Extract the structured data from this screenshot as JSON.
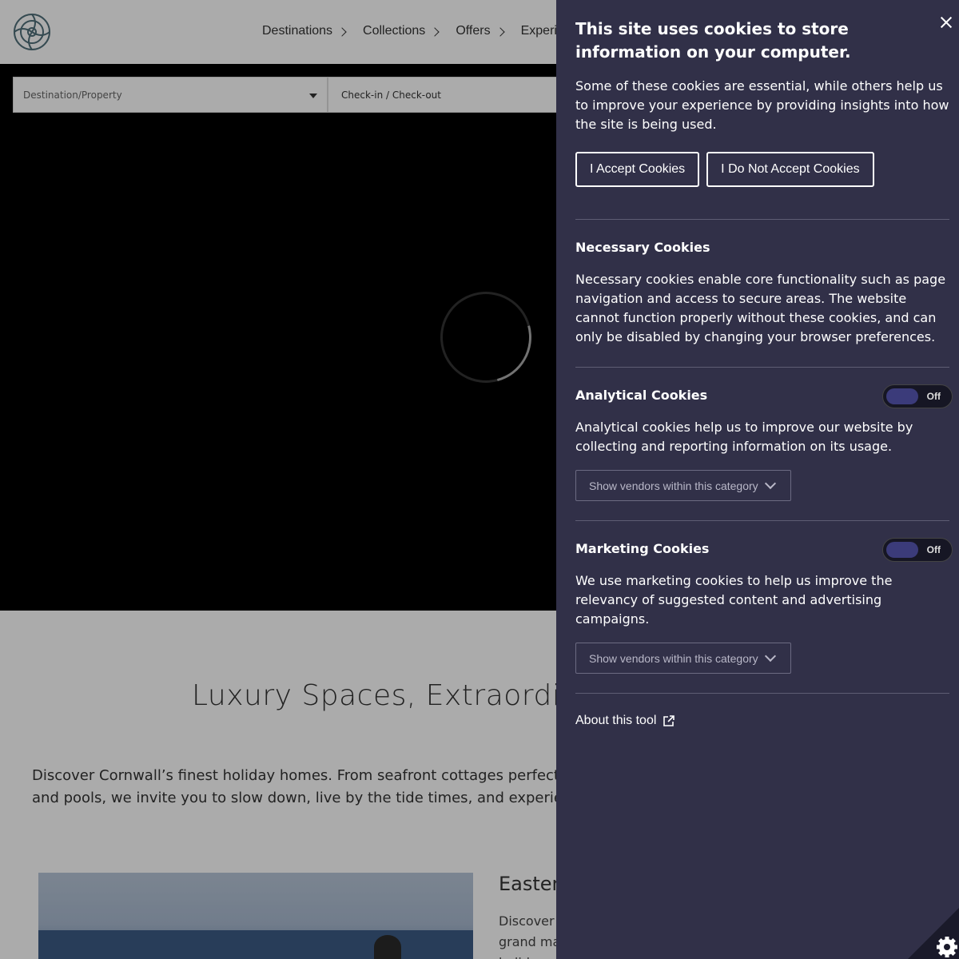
{
  "nav": {
    "items": [
      {
        "label": "Destinations"
      },
      {
        "label": "Collections"
      },
      {
        "label": "Offers"
      },
      {
        "label": "Experiences"
      }
    ]
  },
  "search": {
    "destination_placeholder": "Destination/Property",
    "dates_placeholder": "Check-in / Check-out"
  },
  "intro": {
    "title": "Luxury Spaces, Extraordinary",
    "line1": "Discover Cornwall’s finest holiday homes. From seafront cottages perfect for",
    "line2": "and pools, we invite you to slow down, live by the tide times, and experience"
  },
  "card": {
    "title": "Eastern",
    "line1": "Discover",
    "line2": "grand ma",
    "line3": "holiday"
  },
  "cookie_panel": {
    "title": "This site uses cookies to store information on your computer.",
    "intro": "Some of these cookies are essential, while others help us to improve your experience by providing insights into how the site is being used.",
    "accept_label": "I Accept Cookies",
    "reject_label": "I Do Not Accept Cookies",
    "necessary": {
      "title": "Necessary Cookies",
      "text": "Necessary cookies enable core functionality such as page navigation and access to secure areas. The website cannot function properly without these cookies, and can only be disabled by changing your browser preferences."
    },
    "analytical": {
      "title": "Analytical Cookies",
      "toggle_label": "Off",
      "text": "Analytical cookies help us to improve our website by collecting and reporting information on its usage.",
      "vendors_label": "Show vendors within this category"
    },
    "marketing": {
      "title": "Marketing Cookies",
      "toggle_label": "Off",
      "text": "We use marketing cookies to help us improve the relevancy of suggested content and advertising campaigns.",
      "vendors_label": "Show vendors within this category"
    },
    "about_label": "About this tool"
  },
  "colors": {
    "panel_bg": "#313048",
    "toggle_knob": "#3b3b7a"
  }
}
